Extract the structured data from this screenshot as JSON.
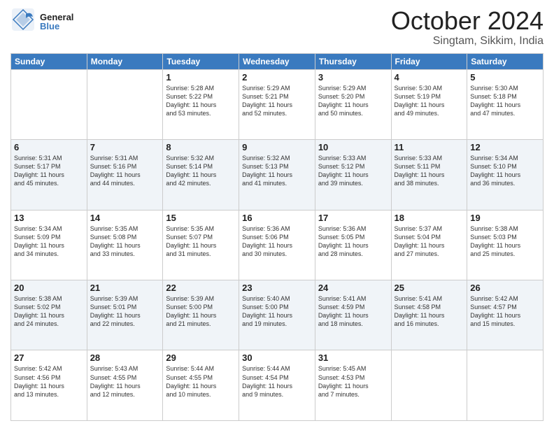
{
  "header": {
    "logo_general": "General",
    "logo_blue": "Blue",
    "month": "October 2024",
    "location": "Singtam, Sikkim, India"
  },
  "weekdays": [
    "Sunday",
    "Monday",
    "Tuesday",
    "Wednesday",
    "Thursday",
    "Friday",
    "Saturday"
  ],
  "weeks": [
    [
      {
        "day": "",
        "content": ""
      },
      {
        "day": "",
        "content": ""
      },
      {
        "day": "1",
        "content": "Sunrise: 5:28 AM\nSunset: 5:22 PM\nDaylight: 11 hours\nand 53 minutes."
      },
      {
        "day": "2",
        "content": "Sunrise: 5:29 AM\nSunset: 5:21 PM\nDaylight: 11 hours\nand 52 minutes."
      },
      {
        "day": "3",
        "content": "Sunrise: 5:29 AM\nSunset: 5:20 PM\nDaylight: 11 hours\nand 50 minutes."
      },
      {
        "day": "4",
        "content": "Sunrise: 5:30 AM\nSunset: 5:19 PM\nDaylight: 11 hours\nand 49 minutes."
      },
      {
        "day": "5",
        "content": "Sunrise: 5:30 AM\nSunset: 5:18 PM\nDaylight: 11 hours\nand 47 minutes."
      }
    ],
    [
      {
        "day": "6",
        "content": "Sunrise: 5:31 AM\nSunset: 5:17 PM\nDaylight: 11 hours\nand 45 minutes."
      },
      {
        "day": "7",
        "content": "Sunrise: 5:31 AM\nSunset: 5:16 PM\nDaylight: 11 hours\nand 44 minutes."
      },
      {
        "day": "8",
        "content": "Sunrise: 5:32 AM\nSunset: 5:14 PM\nDaylight: 11 hours\nand 42 minutes."
      },
      {
        "day": "9",
        "content": "Sunrise: 5:32 AM\nSunset: 5:13 PM\nDaylight: 11 hours\nand 41 minutes."
      },
      {
        "day": "10",
        "content": "Sunrise: 5:33 AM\nSunset: 5:12 PM\nDaylight: 11 hours\nand 39 minutes."
      },
      {
        "day": "11",
        "content": "Sunrise: 5:33 AM\nSunset: 5:11 PM\nDaylight: 11 hours\nand 38 minutes."
      },
      {
        "day": "12",
        "content": "Sunrise: 5:34 AM\nSunset: 5:10 PM\nDaylight: 11 hours\nand 36 minutes."
      }
    ],
    [
      {
        "day": "13",
        "content": "Sunrise: 5:34 AM\nSunset: 5:09 PM\nDaylight: 11 hours\nand 34 minutes."
      },
      {
        "day": "14",
        "content": "Sunrise: 5:35 AM\nSunset: 5:08 PM\nDaylight: 11 hours\nand 33 minutes."
      },
      {
        "day": "15",
        "content": "Sunrise: 5:35 AM\nSunset: 5:07 PM\nDaylight: 11 hours\nand 31 minutes."
      },
      {
        "day": "16",
        "content": "Sunrise: 5:36 AM\nSunset: 5:06 PM\nDaylight: 11 hours\nand 30 minutes."
      },
      {
        "day": "17",
        "content": "Sunrise: 5:36 AM\nSunset: 5:05 PM\nDaylight: 11 hours\nand 28 minutes."
      },
      {
        "day": "18",
        "content": "Sunrise: 5:37 AM\nSunset: 5:04 PM\nDaylight: 11 hours\nand 27 minutes."
      },
      {
        "day": "19",
        "content": "Sunrise: 5:38 AM\nSunset: 5:03 PM\nDaylight: 11 hours\nand 25 minutes."
      }
    ],
    [
      {
        "day": "20",
        "content": "Sunrise: 5:38 AM\nSunset: 5:02 PM\nDaylight: 11 hours\nand 24 minutes."
      },
      {
        "day": "21",
        "content": "Sunrise: 5:39 AM\nSunset: 5:01 PM\nDaylight: 11 hours\nand 22 minutes."
      },
      {
        "day": "22",
        "content": "Sunrise: 5:39 AM\nSunset: 5:00 PM\nDaylight: 11 hours\nand 21 minutes."
      },
      {
        "day": "23",
        "content": "Sunrise: 5:40 AM\nSunset: 5:00 PM\nDaylight: 11 hours\nand 19 minutes."
      },
      {
        "day": "24",
        "content": "Sunrise: 5:41 AM\nSunset: 4:59 PM\nDaylight: 11 hours\nand 18 minutes."
      },
      {
        "day": "25",
        "content": "Sunrise: 5:41 AM\nSunset: 4:58 PM\nDaylight: 11 hours\nand 16 minutes."
      },
      {
        "day": "26",
        "content": "Sunrise: 5:42 AM\nSunset: 4:57 PM\nDaylight: 11 hours\nand 15 minutes."
      }
    ],
    [
      {
        "day": "27",
        "content": "Sunrise: 5:42 AM\nSunset: 4:56 PM\nDaylight: 11 hours\nand 13 minutes."
      },
      {
        "day": "28",
        "content": "Sunrise: 5:43 AM\nSunset: 4:55 PM\nDaylight: 11 hours\nand 12 minutes."
      },
      {
        "day": "29",
        "content": "Sunrise: 5:44 AM\nSunset: 4:55 PM\nDaylight: 11 hours\nand 10 minutes."
      },
      {
        "day": "30",
        "content": "Sunrise: 5:44 AM\nSunset: 4:54 PM\nDaylight: 11 hours\nand 9 minutes."
      },
      {
        "day": "31",
        "content": "Sunrise: 5:45 AM\nSunset: 4:53 PM\nDaylight: 11 hours\nand 7 minutes."
      },
      {
        "day": "",
        "content": ""
      },
      {
        "day": "",
        "content": ""
      }
    ]
  ]
}
